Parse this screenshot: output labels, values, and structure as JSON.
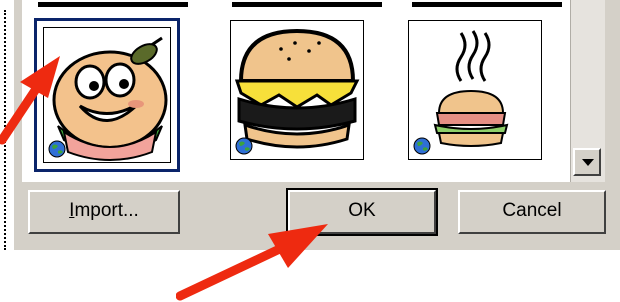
{
  "gallery": {
    "items": [
      {
        "name": "cartoon-burger-face",
        "selected": true
      },
      {
        "name": "cheeseburger",
        "selected": false
      },
      {
        "name": "steaming-sandwich",
        "selected": false
      }
    ],
    "globe_icon": "globe-icon"
  },
  "buttons": {
    "import_label": "Import...",
    "import_mnemonic": "I",
    "ok_label": "OK",
    "cancel_label": "Cancel"
  },
  "annotations": {
    "arrow_color": "#ee2a10"
  },
  "colors": {
    "dialog_face": "#d4d0c8",
    "selection_border": "#0a246a"
  }
}
